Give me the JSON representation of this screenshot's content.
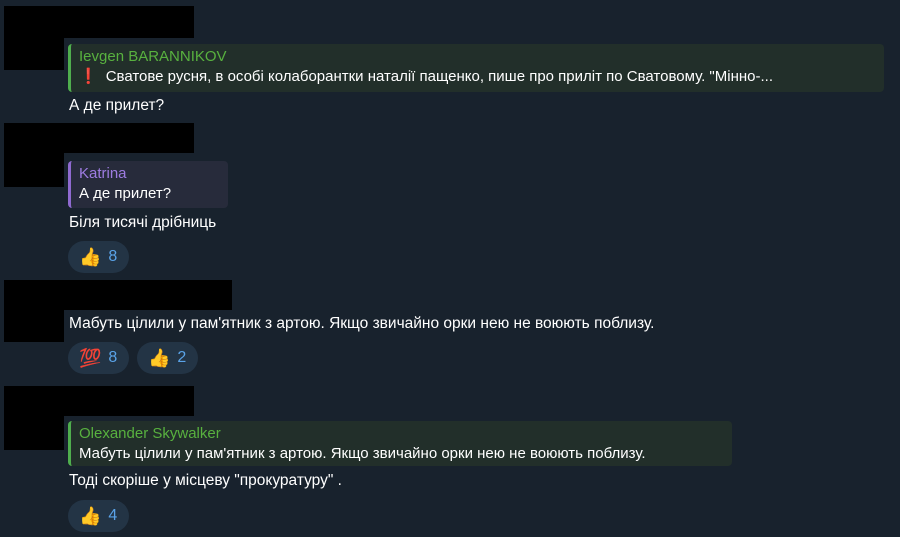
{
  "messages": [
    {
      "reply": {
        "author": "Ievgen BARANNIKOV",
        "icon": "❗",
        "text": "Сватове  русня, в особі колаборантки наталії пащенко, пише про приліт по Сватовому.  \"Мінно-..."
      },
      "text": "А де прилет?"
    },
    {
      "reply": {
        "author": "Katrina",
        "text": "А де прилет?"
      },
      "text": "Біля тисячі дрібниць",
      "reactions": [
        {
          "emoji": "👍",
          "count": "8"
        }
      ]
    },
    {
      "text": "Мабуть цілили у пам'ятник з артою. Якщо звичайно орки нею не воюють поблизу.",
      "reactions": [
        {
          "emoji": "💯",
          "count": "8"
        },
        {
          "emoji": "👍",
          "count": "2"
        }
      ]
    },
    {
      "reply": {
        "author": "Olexander Skywalker",
        "text": "Мабуть цілили у пам'ятник з артою. Якщо звичайно орки нею не воюють поблизу."
      },
      "text": "Тоді скоріше у місцеву  \"прокуратуру\" .",
      "reactions": [
        {
          "emoji": "👍",
          "count": "4"
        }
      ]
    }
  ],
  "colors": {
    "background": "#18222d",
    "reply_green": "#58b13f",
    "reply_purple": "#9e7ce2",
    "reaction_count": "#5aa3e8"
  }
}
